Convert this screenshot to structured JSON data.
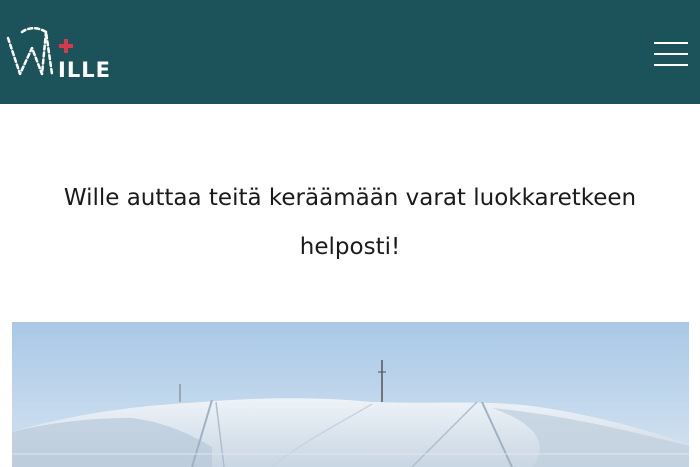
{
  "header": {
    "brand": "ILLE",
    "background_color": "#1c535a",
    "accent_color": "#d63a4a",
    "logo_icon": "wille-logo-icon",
    "menu_icon": "hamburger-menu-icon"
  },
  "main": {
    "headline_line1": "Wille auttaa teitä keräämään varat luokkaretkeen",
    "headline_line2": "helposti!"
  },
  "hero": {
    "image": "snowy-fell-ski-slope-photo"
  }
}
